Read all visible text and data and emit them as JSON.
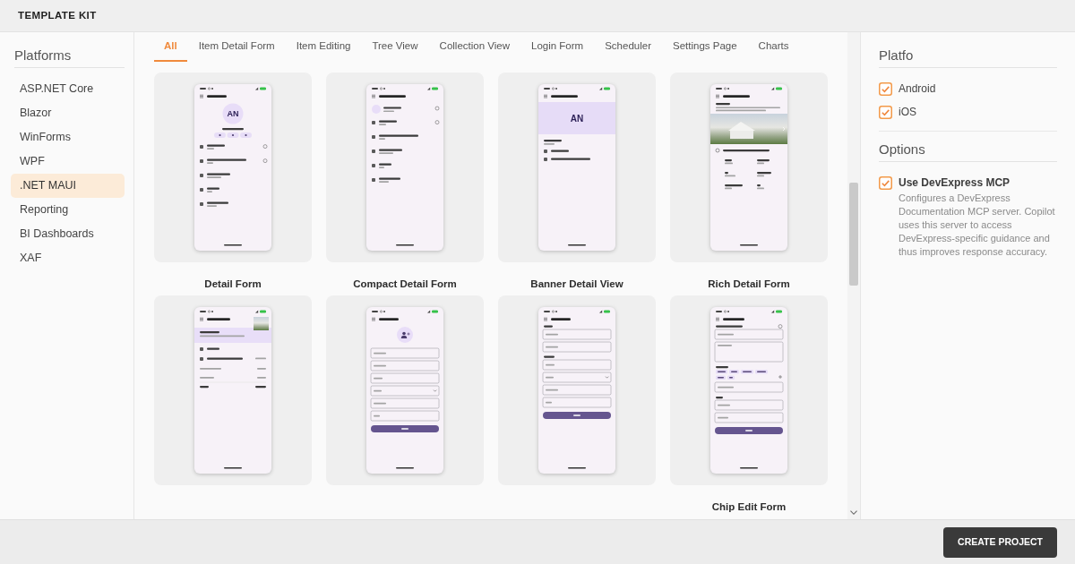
{
  "window": {
    "title": "TEMPLATE KIT"
  },
  "sidebar": {
    "heading": "Platforms",
    "items": [
      {
        "label": "ASP.NET Core",
        "selected": false
      },
      {
        "label": "Blazor",
        "selected": false
      },
      {
        "label": "WinForms",
        "selected": false
      },
      {
        "label": "WPF",
        "selected": false
      },
      {
        "label": ".NET MAUI",
        "selected": true
      },
      {
        "label": "Reporting",
        "selected": false
      },
      {
        "label": "BI Dashboards",
        "selected": false
      },
      {
        "label": "XAF",
        "selected": false
      }
    ]
  },
  "tabs": [
    {
      "label": "All",
      "selected": true
    },
    {
      "label": "Item Detail Form",
      "selected": false
    },
    {
      "label": "Item Editing",
      "selected": false
    },
    {
      "label": "Tree View",
      "selected": false
    },
    {
      "label": "Collection View",
      "selected": false
    },
    {
      "label": "Login Form",
      "selected": false
    },
    {
      "label": "Scheduler",
      "selected": false
    },
    {
      "label": "Settings Page",
      "selected": false
    },
    {
      "label": "Charts",
      "selected": false
    }
  ],
  "templates": [
    {
      "label": "Detail Form",
      "kind": "profile",
      "initials": "AN"
    },
    {
      "label": "Compact Detail Form",
      "kind": "compact"
    },
    {
      "label": "Banner Detail View",
      "kind": "banner",
      "initials": "AN"
    },
    {
      "label": "Rich Detail Form",
      "kind": "listing"
    },
    {
      "kind": "booking"
    },
    {
      "kind": "photoform"
    },
    {
      "kind": "sectionform"
    },
    {
      "label": "Chip Edit Form",
      "kind": "chipform"
    }
  ],
  "settings": {
    "platforms_heading": "Platfo",
    "platforms": [
      {
        "label": "Android",
        "checked": true
      },
      {
        "label": "iOS",
        "checked": true
      }
    ],
    "options_heading": "Options",
    "options": [
      {
        "label": "Use DevExpress MCP",
        "checked": true,
        "description": "Configures a DevExpress Documentation MCP server. Copilot uses this server to access DevExpress-specific guidance and thus improves response accuracy."
      }
    ]
  },
  "footer": {
    "create_button": "CREATE PROJECT"
  }
}
